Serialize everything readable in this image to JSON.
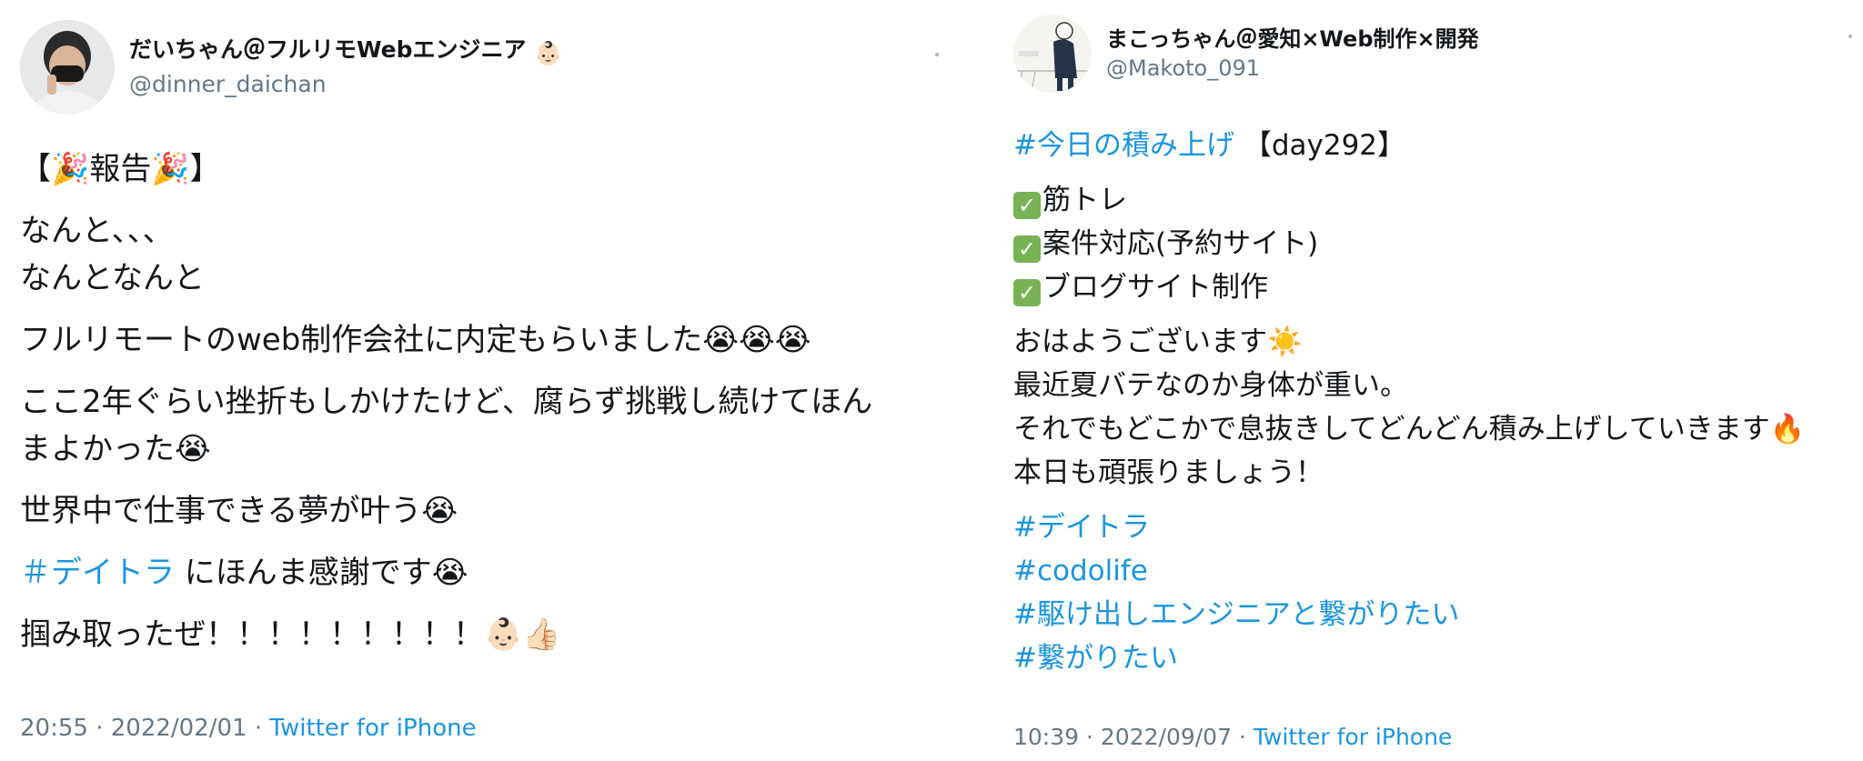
{
  "tweets": [
    {
      "display_name": "だいちゃん＠フルリモWebエンジニア",
      "handle": "@dinner_daichan",
      "paragraphs": [
        [
          "【🎉報告🎉】"
        ],
        [
          "なんと、、、",
          "なんとなんと"
        ],
        [
          "フルリモートのweb制作会社に内定もらいました😭😭😭"
        ],
        [
          "ここ2年ぐらい挫折もしかけたけど、腐らず挑戦し続けてほん",
          "まよかった😭"
        ],
        [
          "世界中で仕事できる夢が叶う😭"
        ],
        [
          "掴み取ったぜ！！！！！！！！！👶🏻👍🏻"
        ]
      ],
      "hashtag_line": {
        "tag": "＃デイトラ",
        "rest": " にほんま感謝です😭"
      },
      "time": "20:55",
      "date": "2022/02/01",
      "source": "Twitter for iPhone"
    },
    {
      "display_name": "まこっちゃん＠愛知×Web制作×開発",
      "handle": "@Makoto_091",
      "first_line": {
        "tag": "#今日の積み上げ",
        "rest": " 【day292】"
      },
      "checklist": [
        "筋トレ",
        "案件対応(予約サイト)",
        "ブログサイト制作"
      ],
      "greeting": [
        "おはようございます☀️",
        "最近夏バテなのか身体が重い。",
        "それでもどこかで息抜きしてどんどん積み上げしていきます🔥",
        "本日も頑張りましょう！"
      ],
      "hashtags": [
        "#デイトラ",
        "#codolife",
        "#駆け出しエンジニアと繋がりたい",
        "#繋がりたい"
      ],
      "time": "10:39",
      "date": "2022/09/07",
      "source": "Twitter for iPhone"
    }
  ],
  "colors": {
    "link": "#1b95e0",
    "muted": "#657786",
    "text": "#14171a"
  },
  "icons": [
    "baby-emoji-icon",
    "more-options-icon",
    "check-mark-icon"
  ]
}
